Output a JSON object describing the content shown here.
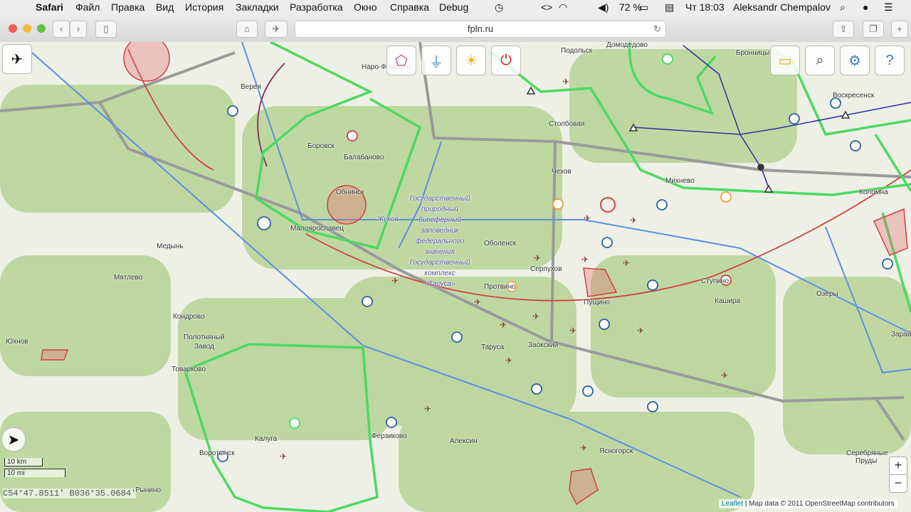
{
  "menubar": {
    "app": "Safari",
    "items": [
      "Файл",
      "Правка",
      "Вид",
      "История",
      "Закладки",
      "Разработка",
      "Окно",
      "Справка",
      "Debug"
    ],
    "battery": "72 %",
    "clock": "Чт 18:03",
    "user": "Aleksandr Chempalov"
  },
  "browser": {
    "url": "fpln.ru"
  },
  "map": {
    "places": [
      {
        "name": "Подольск"
      },
      {
        "name": "Домодедово"
      },
      {
        "name": "Верея"
      },
      {
        "name": "Боровск"
      },
      {
        "name": "Балабаново"
      },
      {
        "name": "Обнинск"
      },
      {
        "name": "Малоярославец"
      },
      {
        "name": "Медынь"
      },
      {
        "name": "Мятлево"
      },
      {
        "name": "Кондрово"
      },
      {
        "name": "Полотняный"
      },
      {
        "name": "Завод"
      },
      {
        "name": "Юхнов"
      },
      {
        "name": "Товарково"
      },
      {
        "name": "Калуга"
      },
      {
        "name": "Воротынск"
      },
      {
        "name": "Ферзиково"
      },
      {
        "name": "Алексин"
      },
      {
        "name": "Таруса"
      },
      {
        "name": "Заокский"
      },
      {
        "name": "Серпухов"
      },
      {
        "name": "Протвино"
      },
      {
        "name": "Оболенск"
      },
      {
        "name": "Пущино"
      },
      {
        "name": "Столбовая"
      },
      {
        "name": "Чехов"
      },
      {
        "name": "Михнево"
      },
      {
        "name": "Ступино"
      },
      {
        "name": "Кашира"
      },
      {
        "name": "Озёры"
      },
      {
        "name": "Ясногорск"
      },
      {
        "name": "Серебряные"
      },
      {
        "name": "Пруды"
      },
      {
        "name": "Коломна"
      },
      {
        "name": "Воскресенск"
      },
      {
        "name": "Бронницы"
      },
      {
        "name": "Жуков"
      },
      {
        "name": "Зарайск"
      },
      {
        "name": "Наро-Фоминск"
      },
      {
        "name": "Рынино"
      }
    ],
    "reserve_lines": [
      "Государственный",
      "природный",
      "биосферный",
      "заповедник",
      "федерального",
      "значения",
      "Государственный",
      "комплекс",
      "«Таруса»"
    ],
    "scale_km": "10 km",
    "scale_mi": "10 mi",
    "coords": "С54°47.8511' В036°35.0684'",
    "attribution_link": "Leaflet",
    "attribution_text": "| Map data © 2011 OpenStreetMap contributors",
    "zoom_in": "+",
    "zoom_out": "−",
    "colors": {
      "zone": "#4cd964",
      "route": "#5b8fe0",
      "road": "#9a9a9a",
      "restricted": "#d04040",
      "airway": "#3030a0"
    }
  }
}
